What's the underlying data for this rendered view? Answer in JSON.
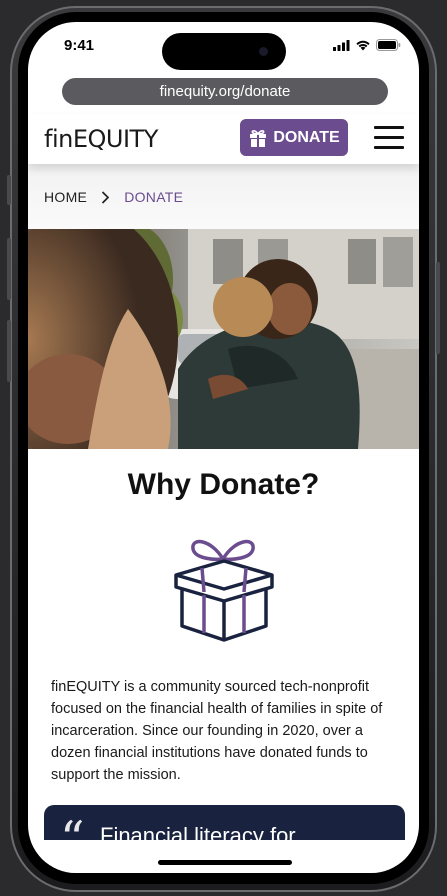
{
  "status_bar": {
    "time": "9:41",
    "icons": [
      "signal-icon",
      "wifi-icon",
      "battery-icon"
    ]
  },
  "browser": {
    "url": "finequity.org/donate"
  },
  "header": {
    "logo": "finEQUITY",
    "donate_label": "DONATE",
    "donate_icon": "gift-icon",
    "menu_icon": "hamburger-icon"
  },
  "breadcrumb": {
    "home": "HOME",
    "separator_icon": "chevron-right-icon",
    "current": "DONATE"
  },
  "hero": {
    "image": "photo-people-hugging"
  },
  "main": {
    "heading": "Why Donate?",
    "illustration": "gift-box-icon",
    "intro": "finEQUITY is a community sourced tech-nonprofit focused on the financial health of families in spite of incarceration. Since our founding in 2020, over a dozen financial institutions have donated funds to support the mission.",
    "quote_mark": "“",
    "quote_text": "Financial literacy for"
  },
  "colors": {
    "brand_purple": "#6b4c8f",
    "navy": "#19233f"
  }
}
